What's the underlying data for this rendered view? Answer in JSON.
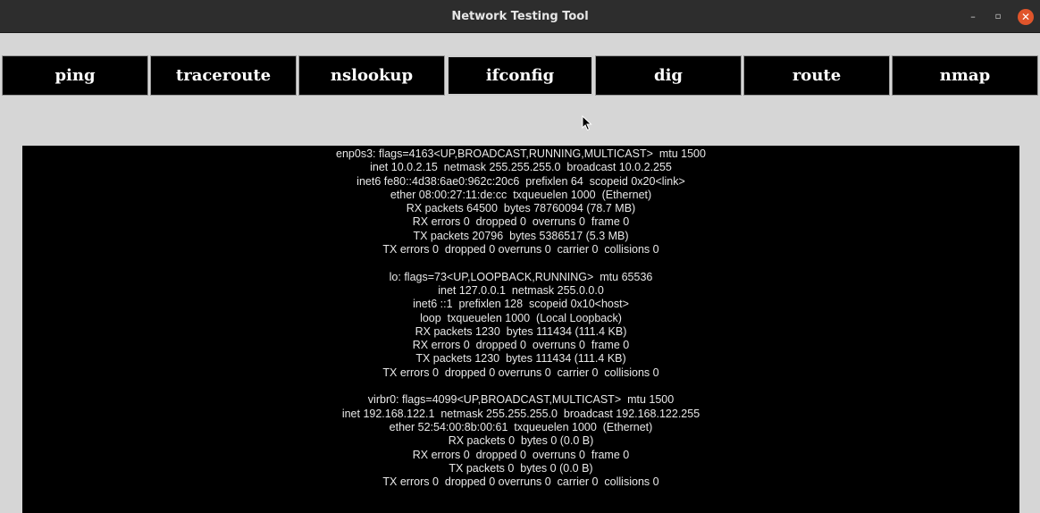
{
  "window": {
    "title": "Network Testing Tool",
    "controls": {
      "minimize": "–",
      "maximize": "▫",
      "close": "✕"
    }
  },
  "tabs": [
    {
      "label": "ping"
    },
    {
      "label": "traceroute"
    },
    {
      "label": "nslookup"
    },
    {
      "label": "ifconfig",
      "active": true
    },
    {
      "label": "dig"
    },
    {
      "label": "route"
    },
    {
      "label": "nmap"
    }
  ],
  "output": {
    "lines": [
      "enp0s3: flags=4163<UP,BROADCAST,RUNNING,MULTICAST>  mtu 1500",
      "inet 10.0.2.15  netmask 255.255.255.0  broadcast 10.0.2.255",
      "inet6 fe80::4d38:6ae0:962c:20c6  prefixlen 64  scopeid 0x20<link>",
      "ether 08:00:27:11:de:cc  txqueuelen 1000  (Ethernet)",
      "RX packets 64500  bytes 78760094 (78.7 MB)",
      "RX errors 0  dropped 0  overruns 0  frame 0",
      "TX packets 20796  bytes 5386517 (5.3 MB)",
      "TX errors 0  dropped 0 overruns 0  carrier 0  collisions 0",
      "",
      "lo: flags=73<UP,LOOPBACK,RUNNING>  mtu 65536",
      "inet 127.0.0.1  netmask 255.0.0.0",
      "inet6 ::1  prefixlen 128  scopeid 0x10<host>",
      "loop  txqueuelen 1000  (Local Loopback)",
      "RX packets 1230  bytes 111434 (111.4 KB)",
      "RX errors 0  dropped 0  overruns 0  frame 0",
      "TX packets 1230  bytes 111434 (111.4 KB)",
      "TX errors 0  dropped 0 overruns 0  carrier 0  collisions 0",
      "",
      "virbr0: flags=4099<UP,BROADCAST,MULTICAST>  mtu 1500",
      "inet 192.168.122.1  netmask 255.255.255.0  broadcast 192.168.122.255",
      "ether 52:54:00:8b:00:61  txqueuelen 1000  (Ethernet)",
      "RX packets 0  bytes 0 (0.0 B)",
      "RX errors 0  dropped 0  overruns 0  frame 0",
      "TX packets 0  bytes 0 (0.0 B)",
      "TX errors 0  dropped 0 overruns 0  carrier 0  collisions 0"
    ]
  },
  "colors": {
    "titlebar": "#2d2d2d",
    "background": "#d6d6d6",
    "tab_bg": "#000000",
    "close_button": "#e0552b"
  }
}
